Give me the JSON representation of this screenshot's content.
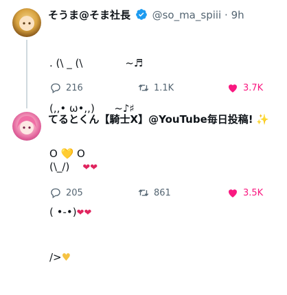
{
  "tweets": [
    {
      "display_name": "そうま@そま社長",
      "handle": "@so_ma_spiii",
      "separator": "·",
      "time": "9h",
      "lines": [
        ". (\\ _ (\\             ~♬",
        "(,,• ω•,,)      ~♪♯",
        "O 💛 O"
      ],
      "replies": "216",
      "retweets": "1.1K",
      "likes": "3.7K"
    },
    {
      "display_name": "てるとくん【騎士X】@YouTube毎日投稿!",
      "name_emoji": "✨",
      "body_line1": "(\\_/)",
      "body_line2": "( •-•)",
      "body_line3": "/>",
      "hearts": "❤❤",
      "replies": "205",
      "retweets": "861",
      "likes": "3.5K"
    }
  ],
  "colors": {
    "like_active": "#f91880",
    "verified": "#1d9bf0",
    "muted": "#536471"
  }
}
